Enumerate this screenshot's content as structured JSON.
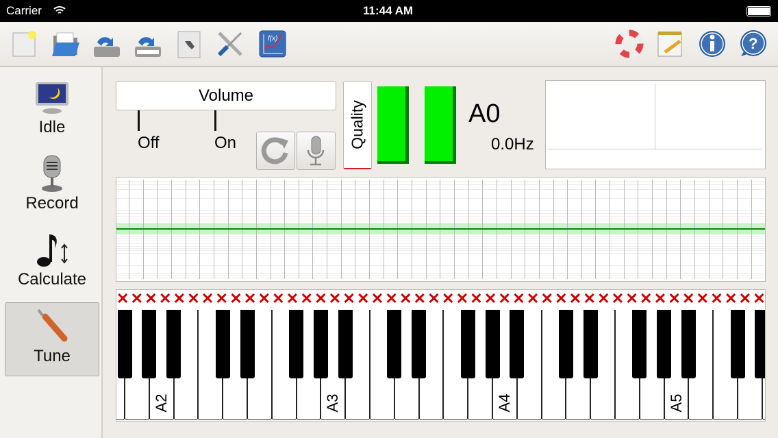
{
  "status_bar": {
    "carrier": "Carrier",
    "time": "11:44 AM"
  },
  "toolbar": {
    "left": [
      {
        "icon": "new-document-icon"
      },
      {
        "icon": "open-folder-icon"
      },
      {
        "icon": "save-icon"
      },
      {
        "icon": "save-as-icon"
      },
      {
        "icon": "document-settings-icon"
      },
      {
        "icon": "tools-icon"
      },
      {
        "icon": "function-graph-icon"
      }
    ],
    "right": [
      {
        "icon": "help-lifebuoy-icon"
      },
      {
        "icon": "notepad-icon"
      },
      {
        "icon": "info-icon"
      },
      {
        "icon": "question-icon"
      }
    ]
  },
  "sidebar": {
    "items": [
      {
        "label": "Idle",
        "icon": "monitor-moon-icon",
        "selected": false
      },
      {
        "label": "Record",
        "icon": "microphone-icon",
        "selected": false
      },
      {
        "label": "Calculate",
        "icon": "music-note-icon",
        "selected": false
      },
      {
        "label": "Tune",
        "icon": "tuning-hammer-icon",
        "selected": true
      }
    ]
  },
  "controls": {
    "volume_label": "Volume",
    "off_label": "Off",
    "on_label": "On",
    "quality_label": "Quality"
  },
  "readout": {
    "note": "A0",
    "frequency": "0.0Hz"
  },
  "keyboard": {
    "labels": [
      "A2",
      "A3",
      "A4",
      "A5"
    ],
    "marker_symbol": "✕"
  },
  "colors": {
    "accent_green": "#00f000",
    "marker_red": "#cc0000"
  }
}
